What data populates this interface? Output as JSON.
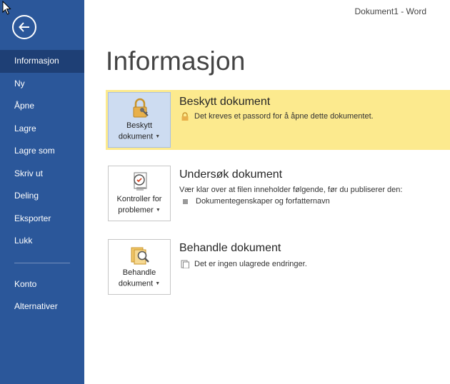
{
  "window": {
    "doc_name": "Dokument1",
    "separator": " - ",
    "app_name": "Word"
  },
  "sidebar": {
    "items": [
      {
        "label": "Informasjon",
        "active": true
      },
      {
        "label": "Ny"
      },
      {
        "label": "Åpne"
      },
      {
        "label": "Lagre"
      },
      {
        "label": "Lagre som"
      },
      {
        "label": "Skriv ut"
      },
      {
        "label": "Deling"
      },
      {
        "label": "Eksporter"
      },
      {
        "label": "Lukk"
      }
    ],
    "bottom_items": [
      {
        "label": "Konto"
      },
      {
        "label": "Alternativer"
      }
    ]
  },
  "main": {
    "title": "Informasjon",
    "sections": [
      {
        "button_line1": "Beskytt",
        "button_line2": "dokument",
        "heading": "Beskytt dokument",
        "text": "Det kreves et passord for å åpne dette dokumentet.",
        "icon": "lock-icon"
      },
      {
        "button_line1": "Kontroller for",
        "button_line2": "problemer",
        "heading": "Undersøk dokument",
        "text": "Vær klar over at filen inneholder følgende, før du publiserer den:",
        "bullet": "Dokumentegenskaper og forfatternavn",
        "icon": "inspect-document-icon"
      },
      {
        "button_line1": "Behandle",
        "button_line2": "dokument",
        "heading": "Behandle dokument",
        "text": "Det er ingen ulagrede endringer.",
        "icon": "manage-document-icon"
      }
    ]
  },
  "colors": {
    "sidebar": "#2b579a",
    "sidebar_active": "#1e3f75",
    "highlight": "#fcea8e"
  }
}
